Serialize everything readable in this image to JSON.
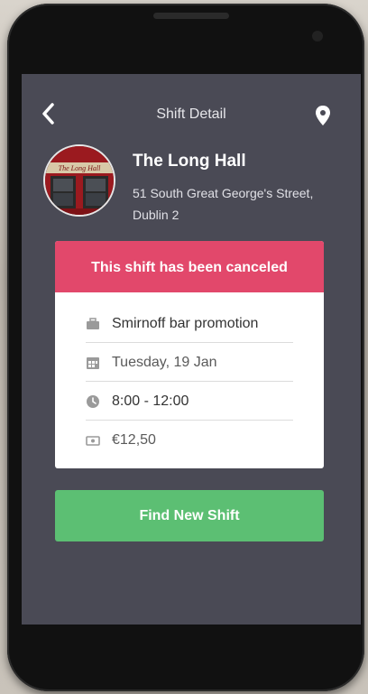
{
  "header": {
    "title": "Shift Detail",
    "back_icon": "chevron-left-icon",
    "location_icon": "map-pin-icon"
  },
  "venue": {
    "name": "The Long Hall",
    "address_line1": "51 South Great George's Street,",
    "address_line2": "Dublin 2",
    "sign_text": "The Long Hall"
  },
  "card": {
    "banner": "This shift has been canceled",
    "banner_color": "#e2486b",
    "details": [
      {
        "icon": "briefcase-icon",
        "text": "Smirnoff bar promotion"
      },
      {
        "icon": "calendar-icon",
        "text": "Tuesday, 19 Jan"
      },
      {
        "icon": "clock-icon",
        "text": "8:00 - 12:00"
      },
      {
        "icon": "cash-icon",
        "text": "€12,50"
      }
    ]
  },
  "actions": {
    "find_new_shift": "Find New Shift",
    "button_color": "#5cbf73"
  }
}
